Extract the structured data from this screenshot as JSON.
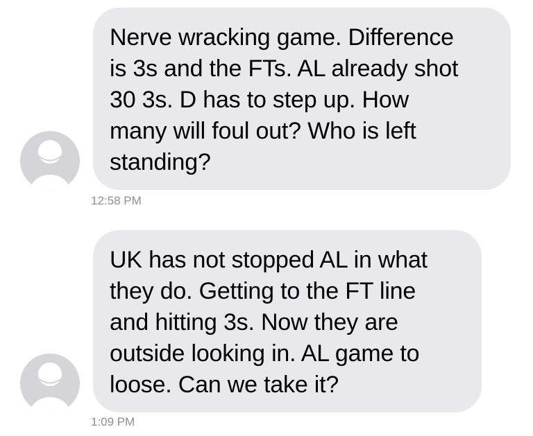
{
  "colors": {
    "bubble_background": "#e9e9eb",
    "avatar_background": "#d5d5d9",
    "avatar_figure": "#ffffff",
    "timestamp_text": "#8e8e93",
    "message_text": "#000000"
  },
  "messages": [
    {
      "text": "Nerve wracking game. Difference\nis 3s and the FTs. AL already shot\n30 3s. D has to step up. How\nmany will foul out? Who is left\nstanding?",
      "time": "12:58 PM",
      "avatar_icon": "person-placeholder-icon"
    },
    {
      "text": "UK has not stopped AL in what\nthey do. Getting to the FT line\nand hitting 3s. Now they are\noutside looking in. AL game to\nloose. Can we take it?",
      "time": "1:09 PM",
      "avatar_icon": "person-placeholder-icon"
    }
  ]
}
